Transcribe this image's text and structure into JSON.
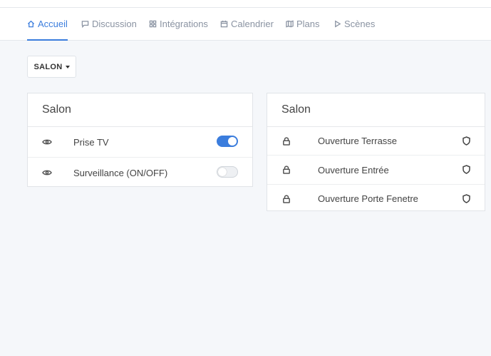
{
  "nav": {
    "tabs": [
      {
        "label": "Accueil",
        "icon": "home-icon",
        "active": true
      },
      {
        "label": "Discussion",
        "icon": "chat-icon",
        "active": false
      },
      {
        "label": "Intégrations",
        "icon": "grid-icon",
        "active": false
      },
      {
        "label": "Calendrier",
        "icon": "calendar-icon",
        "active": false
      },
      {
        "label": "Plans",
        "icon": "map-icon",
        "active": false
      },
      {
        "label": "Scènes",
        "icon": "play-icon",
        "active": false
      }
    ]
  },
  "room_selector": {
    "label": "SALON"
  },
  "switches_card": {
    "title": "Salon",
    "items": [
      {
        "label": "Prise TV",
        "icon": "eye-icon",
        "state": "on"
      },
      {
        "label": "Surveillance (ON/OFF)",
        "icon": "eye-icon",
        "state": "off"
      }
    ]
  },
  "locks_card": {
    "title": "Salon",
    "items": [
      {
        "label": "Ouverture Terrasse",
        "icon": "lock-icon",
        "status_icon": "shield-icon"
      },
      {
        "label": "Ouverture Entrée",
        "icon": "lock-icon",
        "status_icon": "shield-icon"
      },
      {
        "label": "Ouverture Porte Fenetre",
        "icon": "lock-icon",
        "status_icon": "shield-icon"
      }
    ]
  },
  "colors": {
    "accent": "#3b7ddd",
    "background": "#f5f7fa",
    "text": "#444444"
  }
}
